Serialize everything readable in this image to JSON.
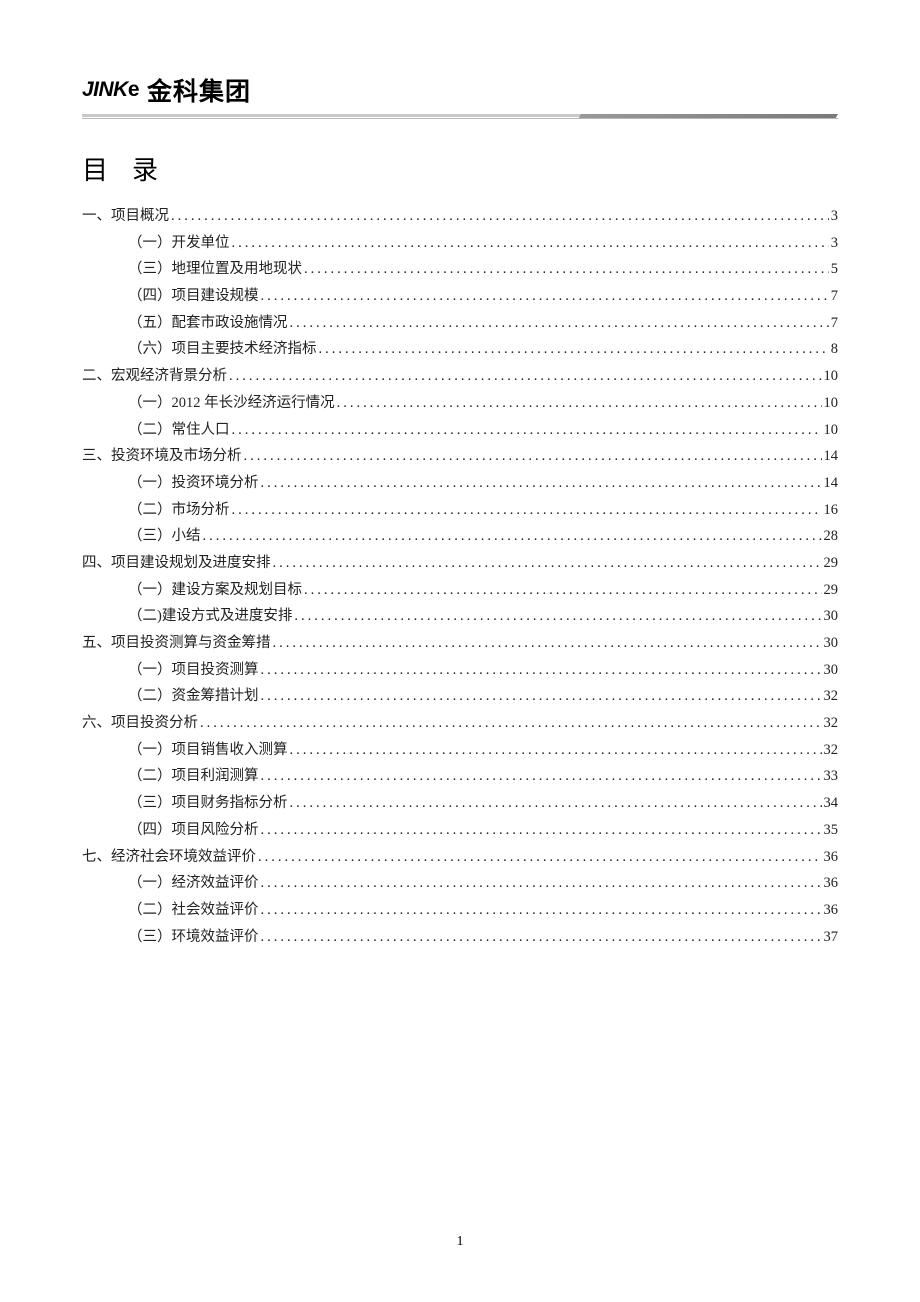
{
  "header": {
    "logo_latin": "JINK",
    "logo_e": "e",
    "company_name": "金科集团"
  },
  "toc_title": "目录",
  "page_number": "1",
  "toc": [
    {
      "level": 1,
      "label": "一、项目概况",
      "page": "3"
    },
    {
      "level": 2,
      "label": "（一）开发单位",
      "page": "3"
    },
    {
      "level": 2,
      "label": "（三）地理位置及用地现状",
      "page": "5"
    },
    {
      "level": 2,
      "label": "（四）项目建设规模",
      "page": "7"
    },
    {
      "level": 2,
      "label": "（五）配套市政设施情况",
      "page": "7"
    },
    {
      "level": 2,
      "label": "（六）项目主要技术经济指标",
      "page": "8"
    },
    {
      "level": 1,
      "label": "二、宏观经济背景分析",
      "page": "10"
    },
    {
      "level": 2,
      "label": "（一）2012 年长沙经济运行情况",
      "page": "10"
    },
    {
      "level": 2,
      "label": "（二）常住人口",
      "page": "10"
    },
    {
      "level": 1,
      "label": "三、投资环境及市场分析",
      "page": "14"
    },
    {
      "level": 2,
      "label": "（一）投资环境分析",
      "page": "14"
    },
    {
      "level": 2,
      "label": "（二）市场分析",
      "page": "16"
    },
    {
      "level": 2,
      "label": "（三）小结",
      "page": "28"
    },
    {
      "level": 1,
      "label": "四、项目建设规划及进度安排",
      "page": "29"
    },
    {
      "level": 2,
      "label": "（一）建设方案及规划目标",
      "page": "29"
    },
    {
      "level": 2,
      "label": "（二)建设方式及进度安排",
      "page": "30"
    },
    {
      "level": 1,
      "label": "五、项目投资测算与资金筹措",
      "page": "30"
    },
    {
      "level": 2,
      "label": "（一）项目投资测算",
      "page": "30"
    },
    {
      "level": 2,
      "label": "（二）资金筹措计划",
      "page": "32"
    },
    {
      "level": 1,
      "label": "六、项目投资分析",
      "page": "32"
    },
    {
      "level": 2,
      "label": "（一）项目销售收入测算",
      "page": "32"
    },
    {
      "level": 2,
      "label": "（二）项目利润测算",
      "page": "33"
    },
    {
      "level": 2,
      "label": "（三）项目财务指标分析",
      "page": "34"
    },
    {
      "level": 2,
      "label": "（四）项目风险分析",
      "page": "35"
    },
    {
      "level": 1,
      "label": "七、经济社会环境效益评价",
      "page": "36"
    },
    {
      "level": 2,
      "label": "（一）经济效益评价",
      "page": "36"
    },
    {
      "level": 2,
      "label": "（二）社会效益评价",
      "page": "36"
    },
    {
      "level": 2,
      "label": "（三）环境效益评价",
      "page": "37"
    }
  ]
}
